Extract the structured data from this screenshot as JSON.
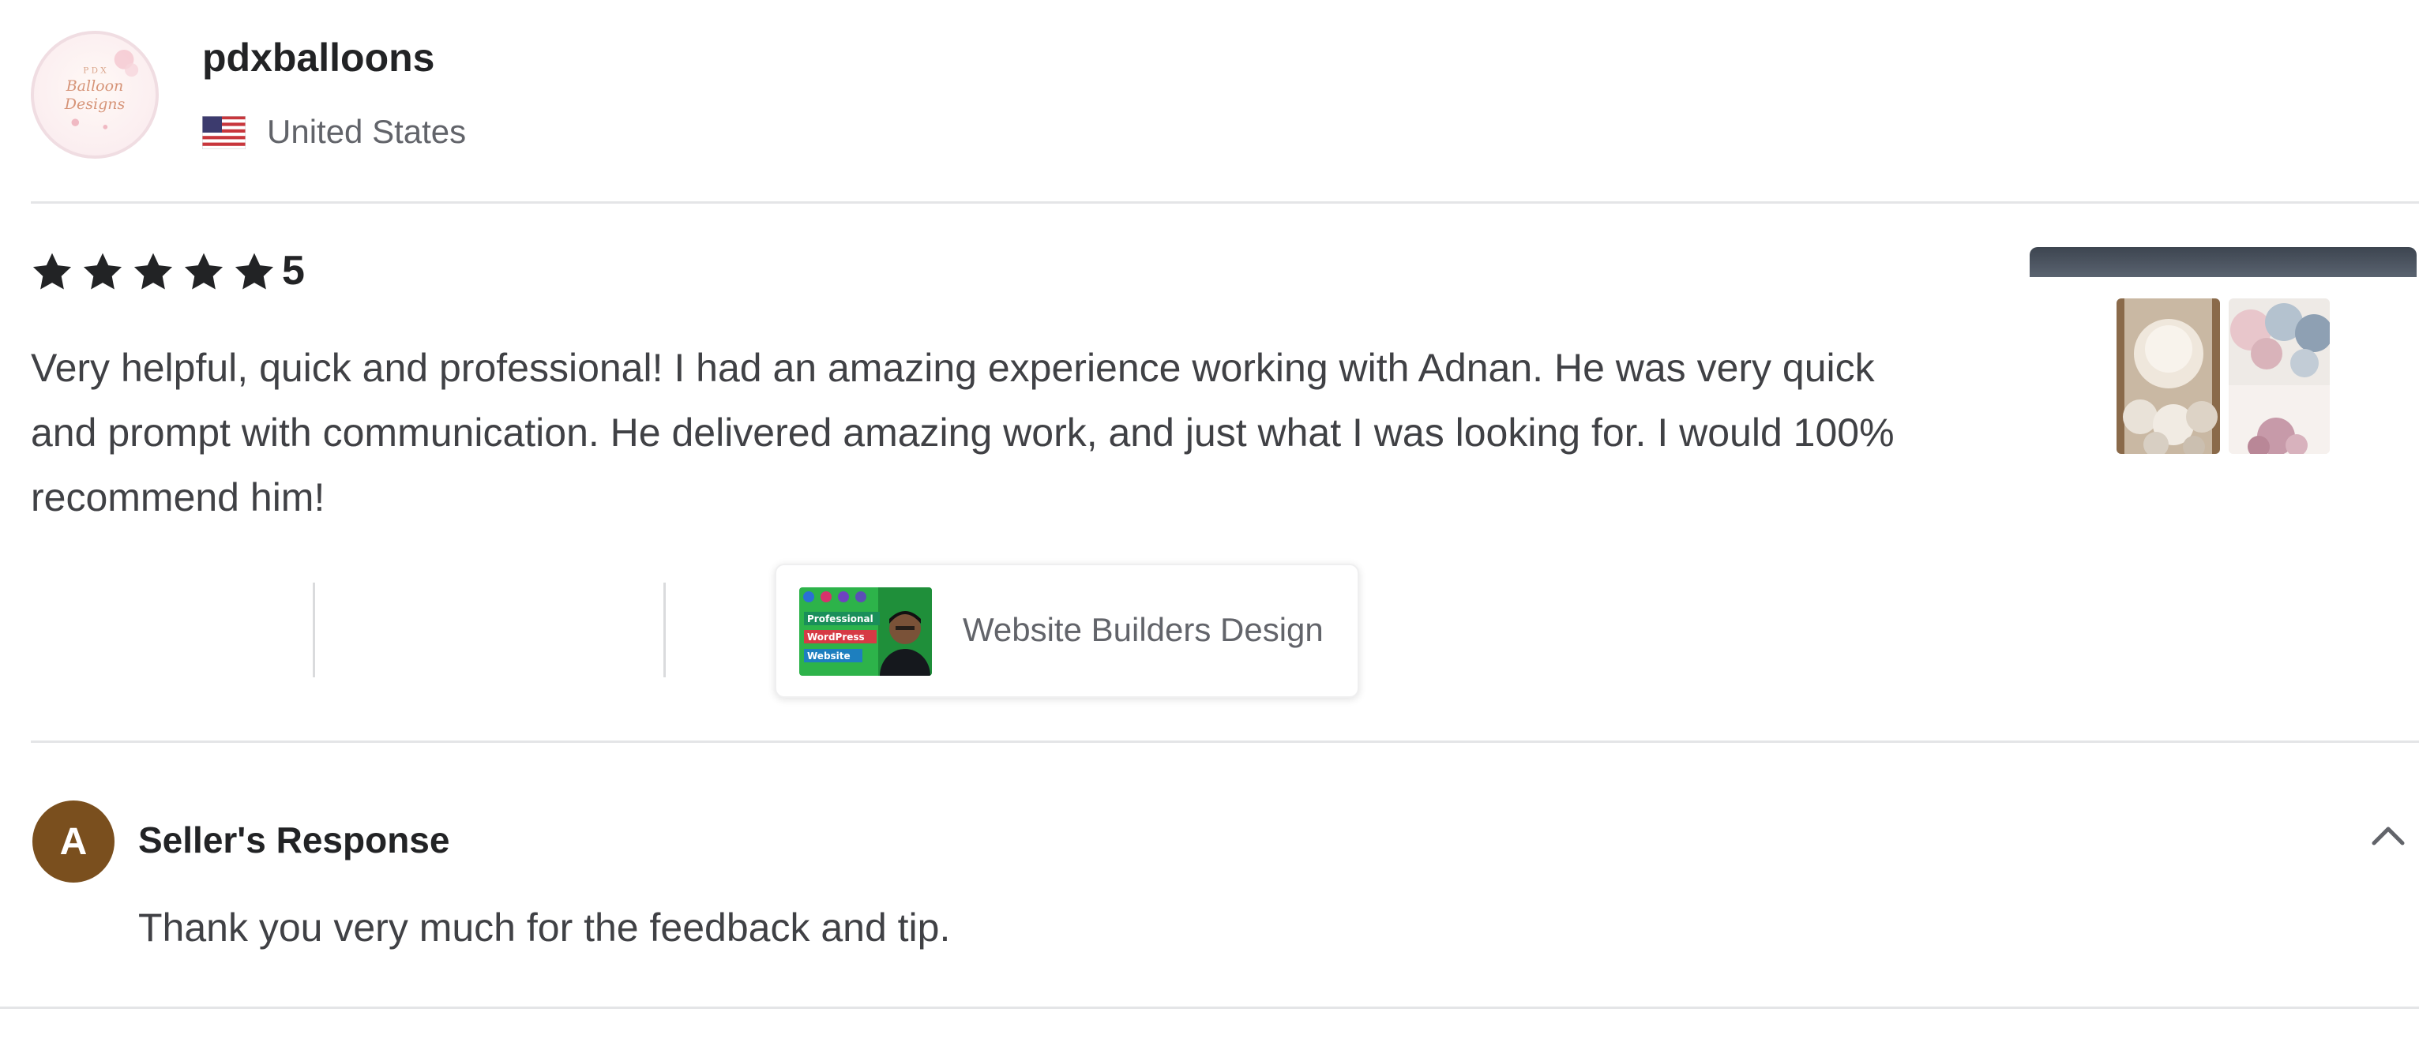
{
  "reviewer": {
    "username": "pdxballoons",
    "country": "United States",
    "avatar_logo_text": [
      "P D X",
      "Balloon",
      "Designs"
    ]
  },
  "review": {
    "rating": "5",
    "stars_filled": 5,
    "stars_total": 5,
    "text": "Very helpful, quick and professional! I had an amazing experience working with Adnan. He was very quick and prompt with communication. He delivered amazing work, and just what I was looking for. I would 100% recommend him!",
    "star_color": "#222325"
  },
  "gig": {
    "title": "Website Builders Design",
    "thumbnail_badges": [
      "Professional",
      "WordPress",
      "Website"
    ]
  },
  "seller_response": {
    "avatar_initial": "A",
    "title": "Seller's Response",
    "text": "Thank you very much for the feedback and tip.",
    "avatar_color": "#7a4f1e"
  },
  "icons": {
    "country_flag": "us-flag-icon",
    "rating": "star-icon",
    "collapse": "chevron-up-icon"
  }
}
